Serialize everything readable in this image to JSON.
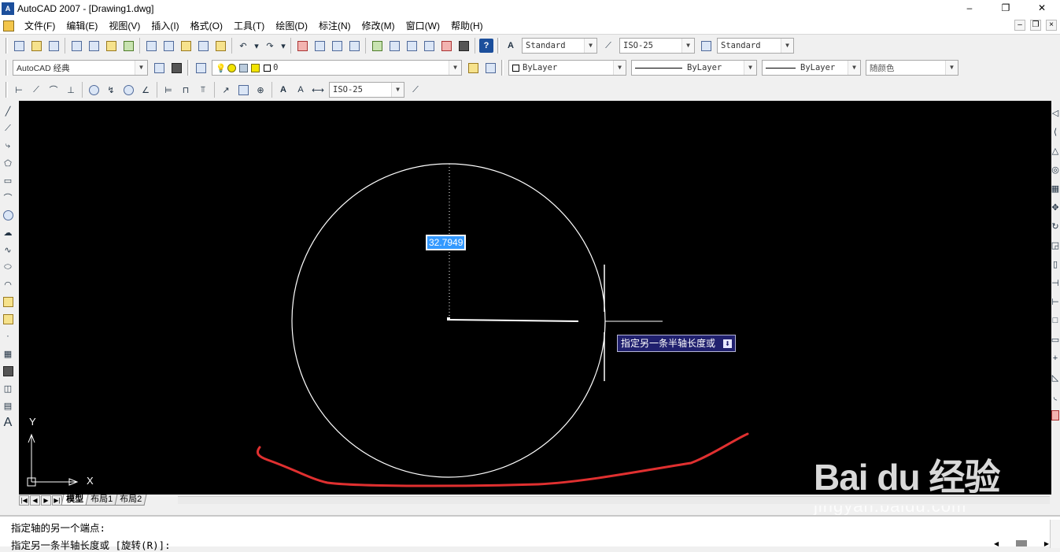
{
  "window": {
    "app_icon": "acad",
    "title": "AutoCAD 2007 - [Drawing1.dwg]",
    "controls": [
      "–",
      "❐",
      "✕"
    ],
    "mdi_controls": [
      "–",
      "❐",
      "×"
    ]
  },
  "menu": [
    "文件(F)",
    "编辑(E)",
    "视图(V)",
    "插入(I)",
    "格式(O)",
    "工具(T)",
    "绘图(D)",
    "标注(N)",
    "修改(M)",
    "窗口(W)",
    "帮助(H)"
  ],
  "toolbar1": {
    "text_style": "Standard",
    "dim_style": "ISO-25",
    "table_style": "Standard"
  },
  "toolbar2": {
    "workspace": "AutoCAD 经典",
    "layer": "0",
    "color": "ByLayer",
    "linetype": "ByLayer",
    "lineweight": "ByLayer",
    "plot_style": "随颜色"
  },
  "toolbar3": {
    "dim_style": "ISO-25"
  },
  "canvas": {
    "background": "#000000",
    "dynamic_input_value": "32.7949",
    "tooltip_text": "指定另一条半轴长度或",
    "ucs_x": "X",
    "ucs_y": "Y",
    "annotation_color": "#e03030"
  },
  "layout_tabs": [
    "模型",
    "布局1",
    "布局2"
  ],
  "command_lines": [
    "指定轴的另一个端点:",
    "指定另一条半轴长度或 [旋转(R)]:"
  ],
  "watermark": {
    "logo": "Bai du 经验",
    "url": "jingyan.baidu.com"
  }
}
